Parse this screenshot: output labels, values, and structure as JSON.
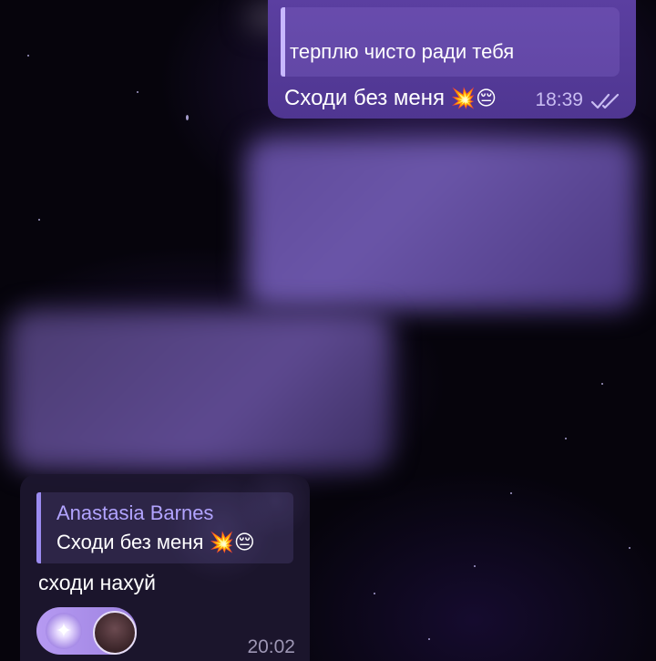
{
  "outgoing_message": {
    "reply_quote_text": "терплю чисто ради тебя",
    "text": "Сходи без меня",
    "emoji": "💥😔",
    "time": "18:39",
    "status": "read"
  },
  "incoming_message": {
    "quote": {
      "author": "Anastasia Barnes",
      "text": "Сходи без меня",
      "emoji": "💥😔"
    },
    "text": "сходи нахуй",
    "time": "20:02"
  },
  "colors": {
    "outgoing_bubble": "#5b3fa1",
    "incoming_bubble": "#1c162e",
    "quote_author": "#b2a4ff",
    "accent_bar": "#c8b8ff"
  },
  "icons": {
    "read_status": "double-check-icon",
    "sparkle": "sparkle-icon",
    "avatar": "user-avatar"
  }
}
